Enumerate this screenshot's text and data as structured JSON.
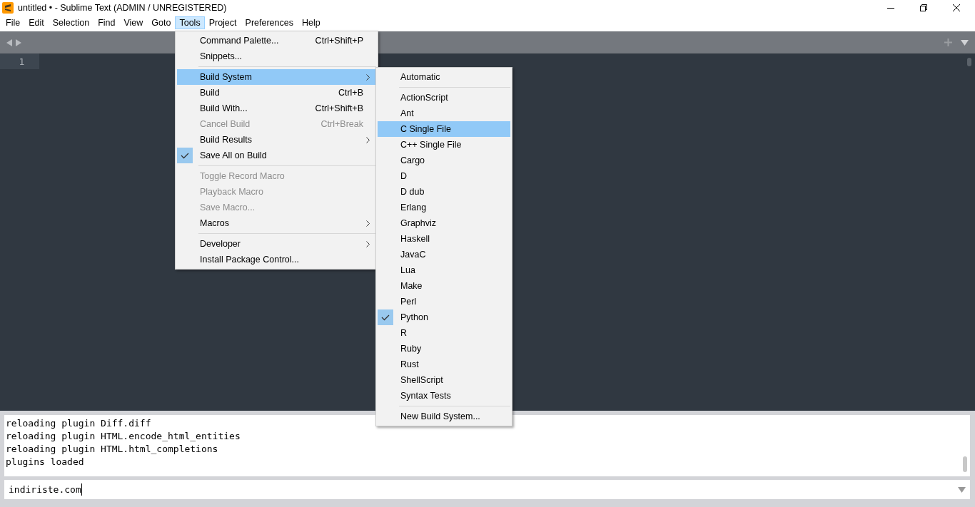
{
  "window": {
    "title": "untitled • - Sublime Text (ADMIN / UNREGISTERED)"
  },
  "menu_bar": [
    {
      "label": "File",
      "selected": false
    },
    {
      "label": "Edit",
      "selected": false
    },
    {
      "label": "Selection",
      "selected": false
    },
    {
      "label": "Find",
      "selected": false
    },
    {
      "label": "View",
      "selected": false
    },
    {
      "label": "Goto",
      "selected": false
    },
    {
      "label": "Tools",
      "selected": true
    },
    {
      "label": "Project",
      "selected": false
    },
    {
      "label": "Preferences",
      "selected": false
    },
    {
      "label": "Help",
      "selected": false
    }
  ],
  "editor": {
    "line_numbers": [
      "1"
    ]
  },
  "tools_menu": {
    "items": [
      {
        "kind": "item",
        "label": "Command Palette...",
        "shortcut": "Ctrl+Shift+P",
        "submenu": false,
        "disabled": false,
        "checked": false,
        "selected": false
      },
      {
        "kind": "item",
        "label": "Snippets...",
        "submenu": false,
        "disabled": false,
        "checked": false,
        "selected": false
      },
      {
        "kind": "separator"
      },
      {
        "kind": "item",
        "label": "Build System",
        "submenu": true,
        "disabled": false,
        "checked": false,
        "selected": true
      },
      {
        "kind": "item",
        "label": "Build",
        "shortcut": "Ctrl+B",
        "submenu": false,
        "disabled": false,
        "checked": false,
        "selected": false
      },
      {
        "kind": "item",
        "label": "Build With...",
        "shortcut": "Ctrl+Shift+B",
        "submenu": false,
        "disabled": false,
        "checked": false,
        "selected": false
      },
      {
        "kind": "item",
        "label": "Cancel Build",
        "shortcut": "Ctrl+Break",
        "submenu": false,
        "disabled": true,
        "checked": false,
        "selected": false
      },
      {
        "kind": "item",
        "label": "Build Results",
        "submenu": true,
        "disabled": false,
        "checked": false,
        "selected": false
      },
      {
        "kind": "item",
        "label": "Save All on Build",
        "submenu": false,
        "disabled": false,
        "checked": true,
        "selected": false
      },
      {
        "kind": "separator"
      },
      {
        "kind": "item",
        "label": "Toggle Record Macro",
        "submenu": false,
        "disabled": true,
        "checked": false,
        "selected": false
      },
      {
        "kind": "item",
        "label": "Playback Macro",
        "submenu": false,
        "disabled": true,
        "checked": false,
        "selected": false
      },
      {
        "kind": "item",
        "label": "Save Macro...",
        "submenu": false,
        "disabled": true,
        "checked": false,
        "selected": false
      },
      {
        "kind": "item",
        "label": "Macros",
        "submenu": true,
        "disabled": false,
        "checked": false,
        "selected": false
      },
      {
        "kind": "separator"
      },
      {
        "kind": "item",
        "label": "Developer",
        "submenu": true,
        "disabled": false,
        "checked": false,
        "selected": false
      },
      {
        "kind": "item",
        "label": "Install Package Control...",
        "submenu": false,
        "disabled": false,
        "checked": false,
        "selected": false
      }
    ]
  },
  "build_system_menu": {
    "items": [
      {
        "kind": "item",
        "label": "Automatic",
        "checked": false,
        "selected": false
      },
      {
        "kind": "separator"
      },
      {
        "kind": "item",
        "label": "ActionScript",
        "checked": false,
        "selected": false
      },
      {
        "kind": "item",
        "label": "Ant",
        "checked": false,
        "selected": false
      },
      {
        "kind": "item",
        "label": "C Single File",
        "checked": false,
        "selected": true
      },
      {
        "kind": "item",
        "label": "C++ Single File",
        "checked": false,
        "selected": false
      },
      {
        "kind": "item",
        "label": "Cargo",
        "checked": false,
        "selected": false
      },
      {
        "kind": "item",
        "label": "D",
        "checked": false,
        "selected": false
      },
      {
        "kind": "item",
        "label": "D dub",
        "checked": false,
        "selected": false
      },
      {
        "kind": "item",
        "label": "Erlang",
        "checked": false,
        "selected": false
      },
      {
        "kind": "item",
        "label": "Graphviz",
        "checked": false,
        "selected": false
      },
      {
        "kind": "item",
        "label": "Haskell",
        "checked": false,
        "selected": false
      },
      {
        "kind": "item",
        "label": "JavaC",
        "checked": false,
        "selected": false
      },
      {
        "kind": "item",
        "label": "Lua",
        "checked": false,
        "selected": false
      },
      {
        "kind": "item",
        "label": "Make",
        "checked": false,
        "selected": false
      },
      {
        "kind": "item",
        "label": "Perl",
        "checked": false,
        "selected": false
      },
      {
        "kind": "item",
        "label": "Python",
        "checked": true,
        "selected": false
      },
      {
        "kind": "item",
        "label": "R",
        "checked": false,
        "selected": false
      },
      {
        "kind": "item",
        "label": "Ruby",
        "checked": false,
        "selected": false
      },
      {
        "kind": "item",
        "label": "Rust",
        "checked": false,
        "selected": false
      },
      {
        "kind": "item",
        "label": "ShellScript",
        "checked": false,
        "selected": false
      },
      {
        "kind": "item",
        "label": "Syntax Tests",
        "checked": false,
        "selected": false
      },
      {
        "kind": "separator"
      },
      {
        "kind": "item",
        "label": "New Build System...",
        "checked": false,
        "selected": false
      }
    ]
  },
  "console": {
    "lines": [
      "reloading plugin Diff.diff",
      "reloading plugin HTML.encode_html_entities",
      "reloading plugin HTML.html_completions",
      "plugins loaded"
    ],
    "input_value": "indiriste.com"
  }
}
